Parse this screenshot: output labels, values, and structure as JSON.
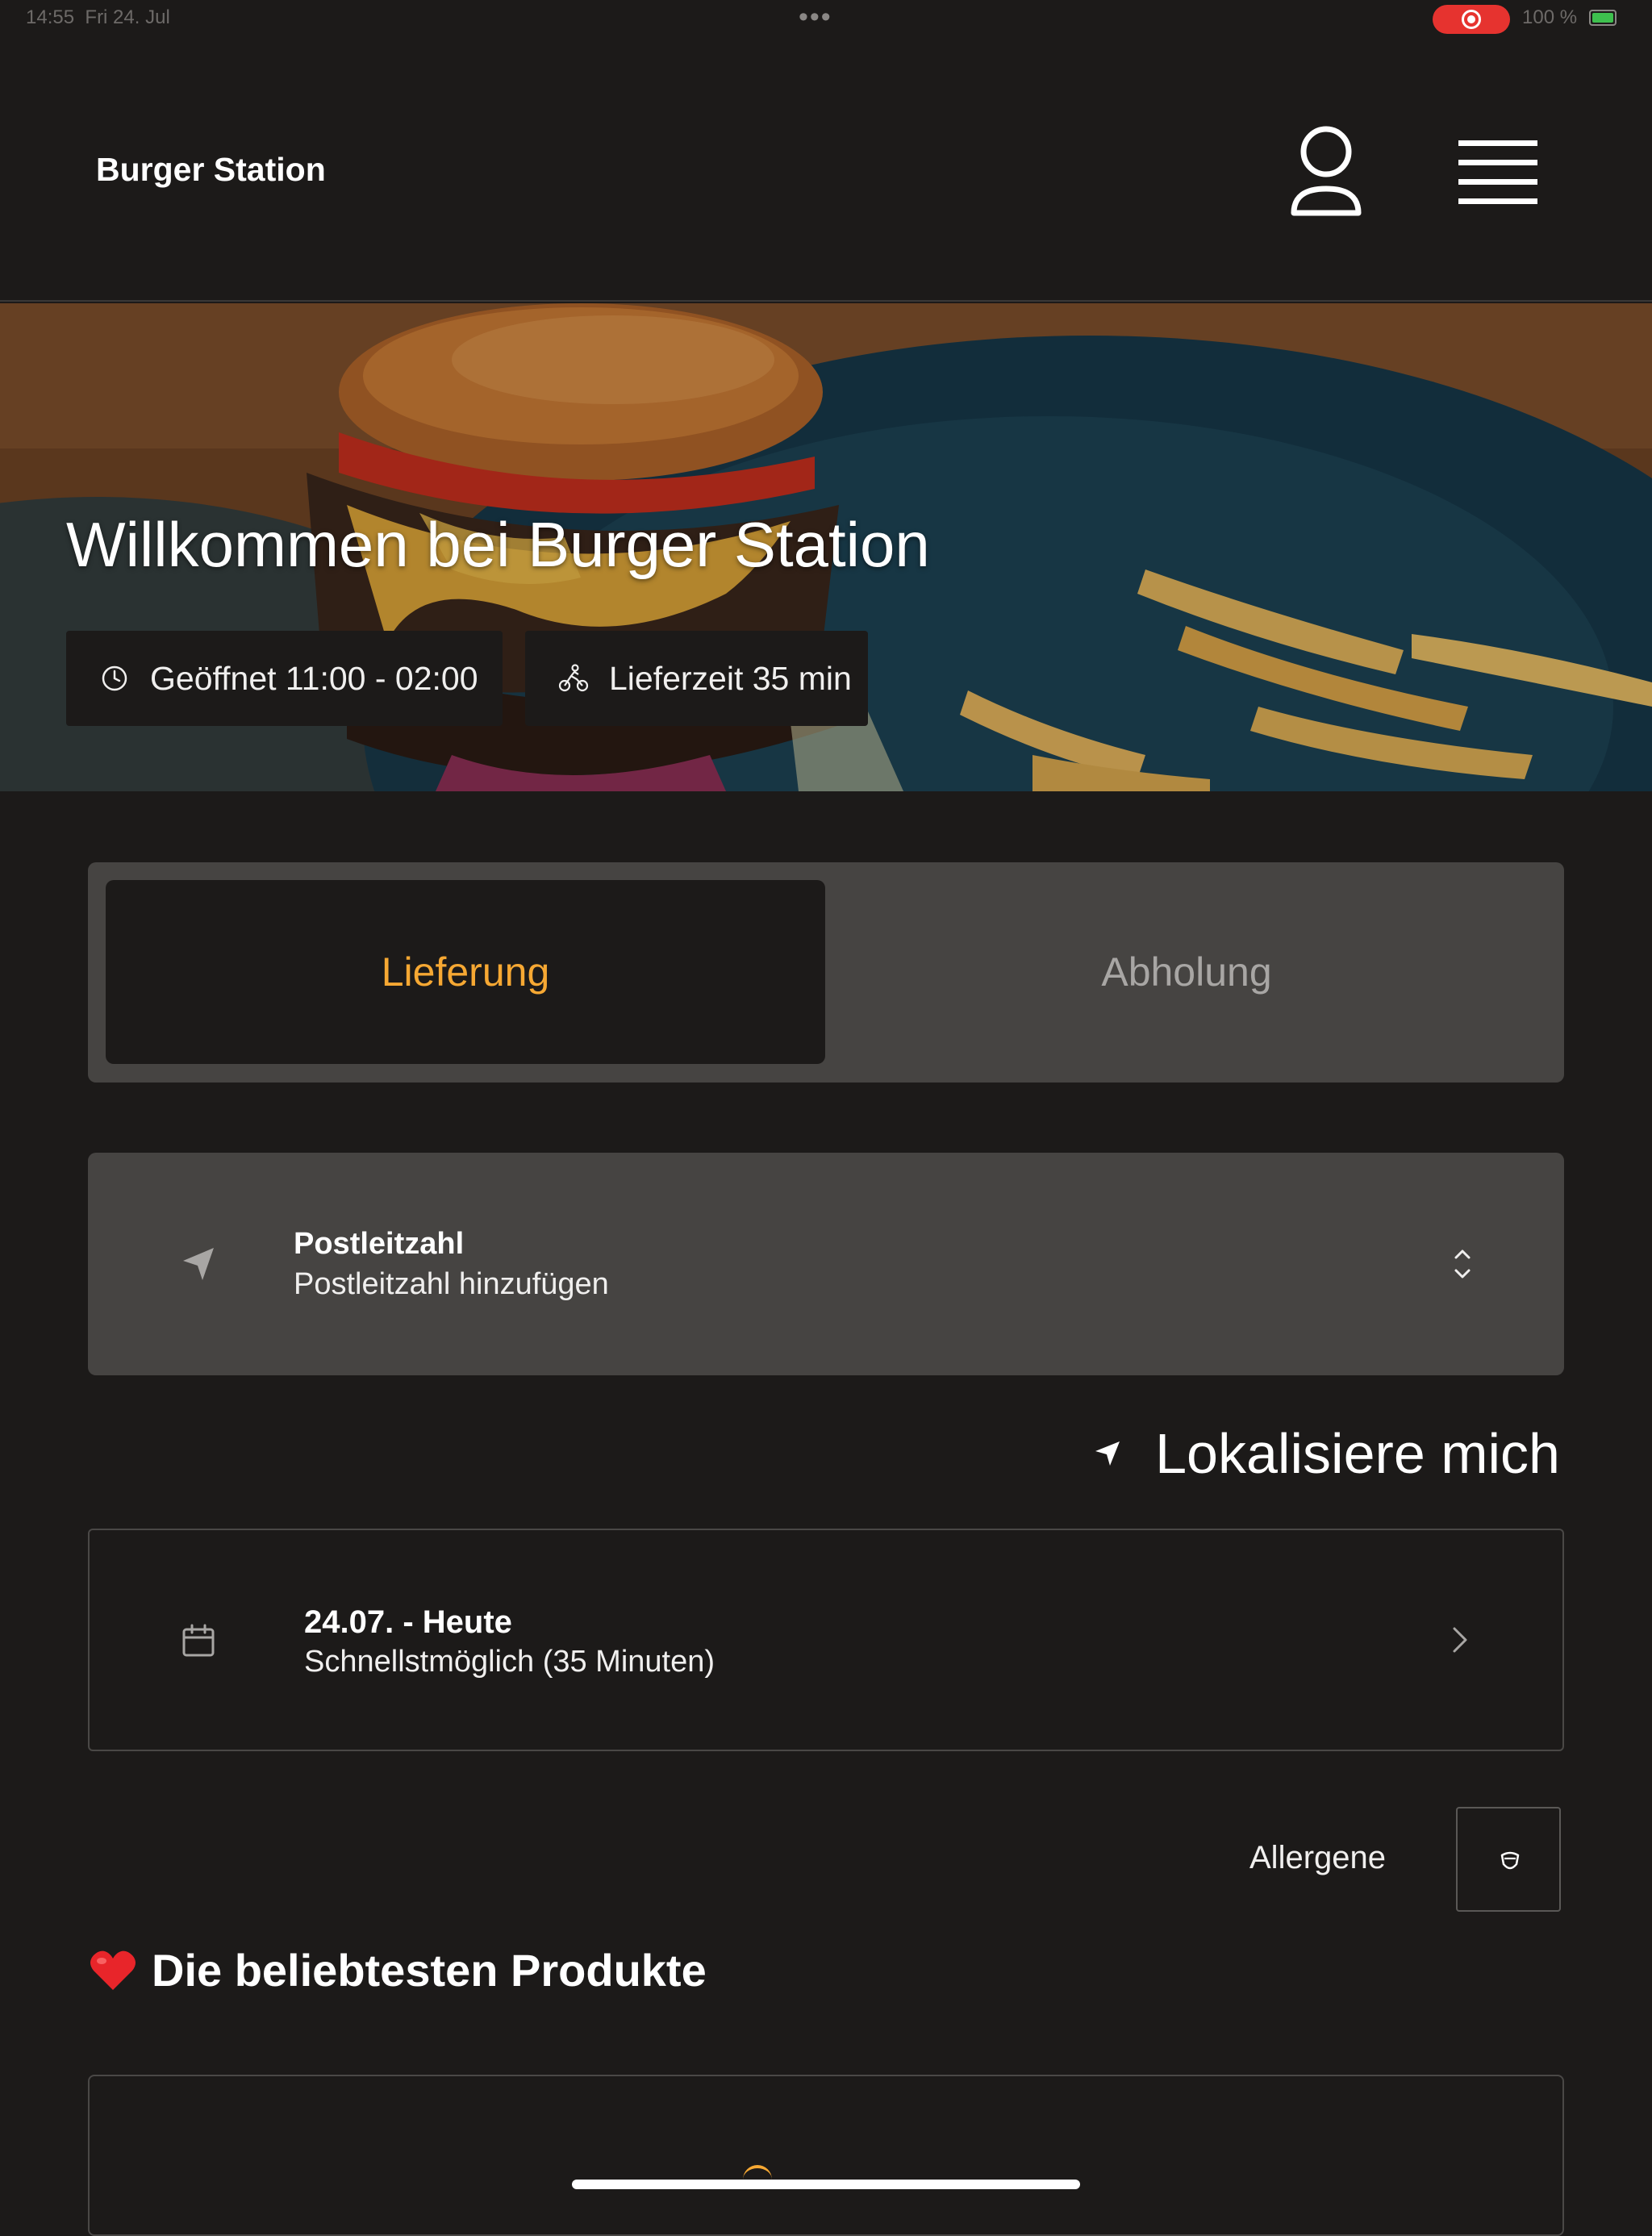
{
  "status_bar": {
    "time": "14:55",
    "date": "Fri 24. Jul",
    "battery": "100 %"
  },
  "header": {
    "brand": "Burger Station",
    "icons": [
      "user-icon",
      "menu-icon"
    ]
  },
  "hero": {
    "title": "Willkommen bei Burger Station",
    "opening_hours": "Geöffnet 11:00 - 02:00",
    "delivery_time": "Lieferzeit 35 min"
  },
  "tabs": {
    "delivery": "Lieferung",
    "pickup": "Abholung",
    "active": "delivery"
  },
  "postcode": {
    "title": "Postleitzahl",
    "placeholder": "Postleitzahl hinzufügen"
  },
  "locate": {
    "label": "Lokalisiere mich"
  },
  "date_picker": {
    "title": "24.07. - Heute",
    "subtitle": "Schnellstmöglich (35 Minuten)"
  },
  "allergens": {
    "label": "Allergene"
  },
  "products": {
    "section_title": "Die beliebtesten Produkte"
  },
  "colors": {
    "background": "#1c1a19",
    "accent": "#f6a833",
    "card": "#464442"
  }
}
